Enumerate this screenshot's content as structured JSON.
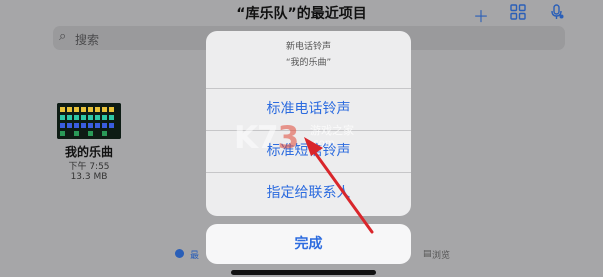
{
  "window": {
    "title": "“库乐队”的最近项目"
  },
  "toolbar": {
    "add_icon": "plus-icon",
    "grid_icon": "grid-icon",
    "mic_icon": "microphone-icon"
  },
  "search": {
    "placeholder": "搜索"
  },
  "file": {
    "name": "我的乐曲",
    "time": "下午 7:55",
    "size": "13.3 MB"
  },
  "bottom_bar": {
    "recent_label": "最",
    "browse_label": "浏览"
  },
  "action_sheet": {
    "title": "新电话铃声",
    "subtitle": "“我的乐曲”",
    "options": [
      {
        "label": "标准电话铃声"
      },
      {
        "label": "标准短信铃声"
      },
      {
        "label": "指定给联系人"
      }
    ],
    "done_label": "完成"
  },
  "watermark": {
    "logo_k": "K7",
    "logo_3": "3",
    "site": "游戏之家",
    "domain": ".com"
  },
  "colors": {
    "accent": "#2d6cdf",
    "arrow": "#d9262b"
  }
}
